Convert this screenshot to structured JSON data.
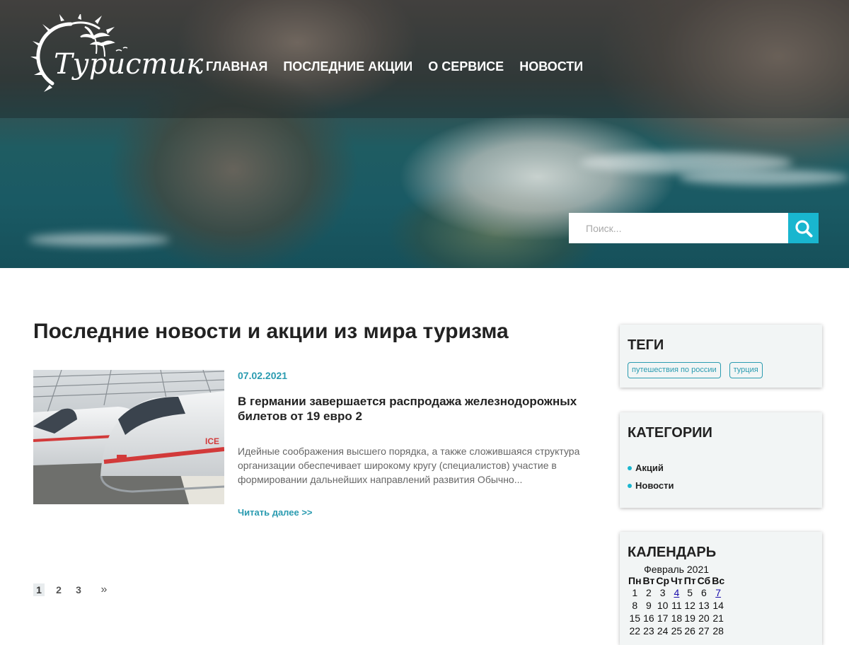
{
  "brand": {
    "logo_text": "Туристик"
  },
  "nav": {
    "items": [
      {
        "label": "ГЛАВНАЯ"
      },
      {
        "label": "ПОСЛЕДНИЕ АКЦИИ"
      },
      {
        "label": "О СЕРВИСЕ"
      },
      {
        "label": "НОВОСТИ"
      }
    ]
  },
  "search": {
    "placeholder": "Поиск...",
    "value": ""
  },
  "main": {
    "title": "Последние новости и акции из мира туризма",
    "posts": [
      {
        "date": "07.02.2021",
        "title": "В германии завершается распродажа железнодорожных билетов от 19 евро 2",
        "excerpt": "Идейные соображения высшего порядка, а также сложившаяся структура организации обеспечивает широкому кругу (специалистов) участие в формировании дальнейших направлений развития Обычно...",
        "read_more": "Читать далее >>"
      }
    ],
    "pagination": {
      "pages": [
        "1",
        "2",
        "3"
      ],
      "current": "1",
      "next": "»"
    }
  },
  "sidebar": {
    "tags": {
      "title": "ТЕГИ",
      "items": [
        "путешествия по россии",
        "турция"
      ]
    },
    "categories": {
      "title": "КАТЕГОРИИ",
      "items": [
        "Акций",
        "Новости"
      ]
    },
    "calendar": {
      "title": "КАЛЕНДАРЬ",
      "caption": "Февраль 2021",
      "weekdays": [
        "Пн",
        "Вт",
        "Ср",
        "Чт",
        "Пт",
        "Сб",
        "Вс"
      ],
      "rows": [
        [
          "1",
          "2",
          "3",
          "4",
          "5",
          "6",
          "7"
        ],
        [
          "8",
          "9",
          "10",
          "11",
          "12",
          "13",
          "14"
        ],
        [
          "15",
          "16",
          "17",
          "18",
          "19",
          "20",
          "21"
        ],
        [
          "22",
          "23",
          "24",
          "25",
          "26",
          "27",
          "28"
        ]
      ],
      "linked_days": [
        "4",
        "7"
      ]
    }
  },
  "colors": {
    "accent": "#19b6cf",
    "link": "#2a9bb0",
    "heading": "#222222"
  }
}
